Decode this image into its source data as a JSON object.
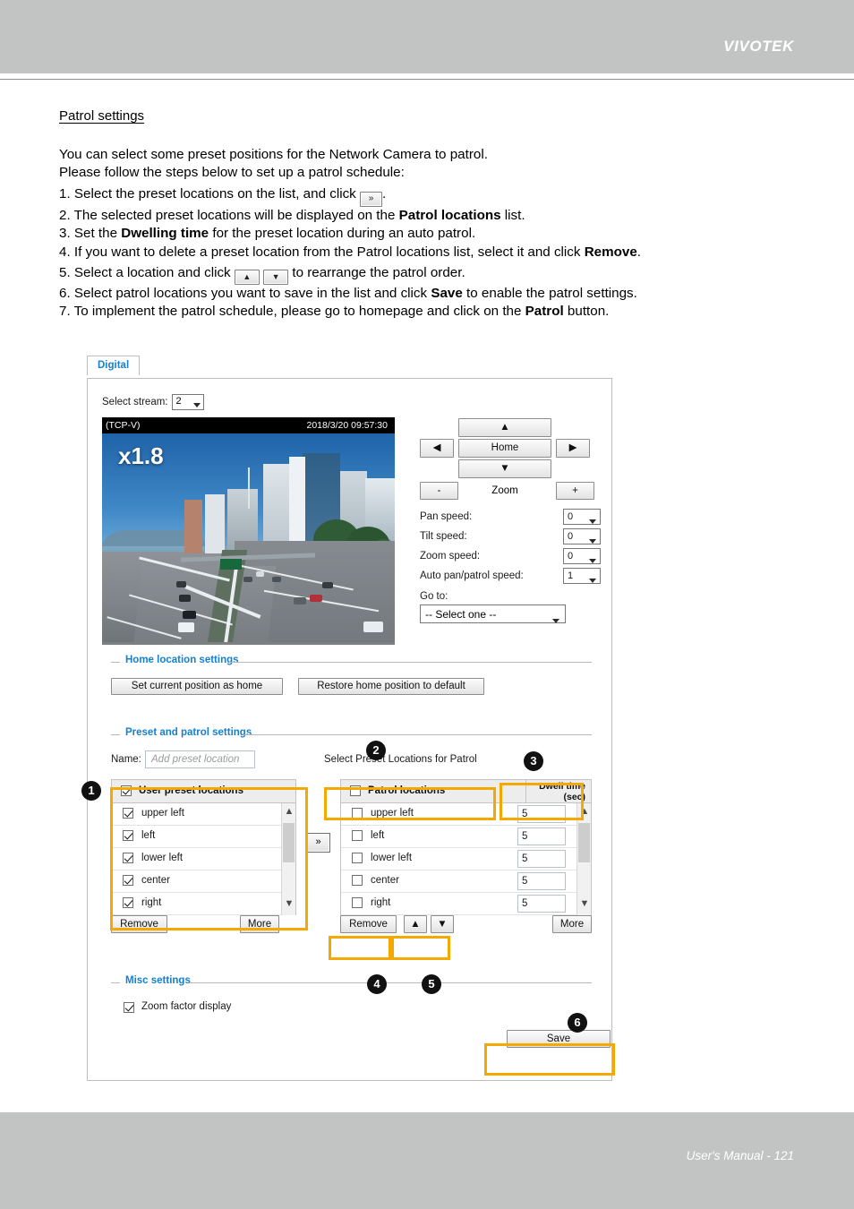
{
  "header": {
    "brand": "VIVOTEK"
  },
  "footer": {
    "text": "User's Manual - 121"
  },
  "doc": {
    "section_title": "Patrol settings",
    "intro_line1": "You can select some preset positions for the Network Camera to patrol.",
    "intro_line2": "Please follow the steps below to set up a patrol schedule:",
    "step1_a": "1. Select the preset locations on the list, and click",
    "step1_icon": "»",
    "step1_b": ".",
    "step2_a": "2. The selected preset locations will be displayed on the ",
    "step2_b": "Patrol locations",
    "step2_c": " list.",
    "step3_a": "3. Set the ",
    "step3_b": "Dwelling time",
    "step3_c": " for the preset location during an auto patrol.",
    "step4_a": "4. If you want to delete a preset location from the Patrol locations list, select it and click ",
    "step4_b": "Remove",
    "step4_c": ".",
    "step5_a": "5. Select a location and click",
    "step5_up": "▲",
    "step5_dn": "▼",
    "step5_b": "to rearrange the patrol order.",
    "step6_a": "6. Select patrol locations you want to save in the list and click ",
    "step6_b": "Save",
    "step6_c": " to enable the patrol settings.",
    "step7_a": "7. To implement the patrol schedule, please go to homepage and click on the ",
    "step7_b": "Patrol",
    "step7_c": " button."
  },
  "app": {
    "tab": "Digital",
    "stream": {
      "label": "Select stream:",
      "value": "2"
    },
    "video": {
      "protocol": "(TCP-V)",
      "timestamp": "2018/3/20 09:57:30",
      "zoom_factor": "x1.8"
    },
    "ptz": {
      "up": "▲",
      "left": "◀",
      "home": "Home",
      "right": "▶",
      "down": "▼",
      "zoom_out": "-",
      "zoom_label": "Zoom",
      "zoom_in": "+",
      "speeds": [
        {
          "label": "Pan speed:",
          "value": "0"
        },
        {
          "label": "Tilt speed:",
          "value": "0"
        },
        {
          "label": "Zoom speed:",
          "value": "0"
        },
        {
          "label": "Auto pan/patrol speed:",
          "value": "1"
        }
      ],
      "goto_label": "Go to:",
      "goto_value": "-- Select one --"
    },
    "home_settings": {
      "legend": "Home location settings",
      "set_home": "Set current position as home",
      "restore_home": "Restore home position to default"
    },
    "preset_settings": {
      "legend": "Preset and patrol settings",
      "name_label": "Name:",
      "name_placeholder": "Add preset location",
      "select_header": "Select Preset Locations for Patrol",
      "left_list": {
        "header": "User preset locations",
        "header_checked": true,
        "items": [
          {
            "label": "upper left",
            "checked": true
          },
          {
            "label": "left",
            "checked": true
          },
          {
            "label": "lower left",
            "checked": true
          },
          {
            "label": "center",
            "checked": true
          },
          {
            "label": "right",
            "checked": true
          }
        ],
        "remove": "Remove",
        "more": "More"
      },
      "transfer_button": "»",
      "right_list": {
        "header": "Patrol locations",
        "header_checked": false,
        "dwell_header_line1": "Dwell time",
        "dwell_header_line2": "(sec)",
        "items": [
          {
            "label": "upper left",
            "checked": false,
            "dwell": "5"
          },
          {
            "label": "left",
            "checked": false,
            "dwell": "5"
          },
          {
            "label": "lower left",
            "checked": false,
            "dwell": "5"
          },
          {
            "label": "center",
            "checked": false,
            "dwell": "5"
          },
          {
            "label": "right",
            "checked": false,
            "dwell": "5"
          }
        ],
        "remove": "Remove",
        "move_up": "▲",
        "move_down": "▼",
        "more": "More"
      }
    },
    "misc_settings": {
      "legend": "Misc settings",
      "zoom_factor_display": "Zoom factor display",
      "zoom_factor_checked": true
    },
    "save_button": "Save"
  },
  "callouts": [
    {
      "number": "1"
    },
    {
      "number": "2"
    },
    {
      "number": "3"
    },
    {
      "number": "4"
    },
    {
      "number": "5"
    },
    {
      "number": "6"
    }
  ],
  "colors": {
    "brand_gray": "#c2c4c4",
    "highlight_orange": "#F5A800",
    "legend_blue": "#1680cf",
    "tab_blue": "#1680cf"
  }
}
